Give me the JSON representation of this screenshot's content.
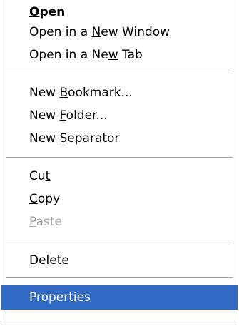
{
  "colors": {
    "highlight": "#316ac5",
    "highlight_text": "#ffffff",
    "disabled_text": "#a6a6a6",
    "separator": "#a0a0a0"
  },
  "menu": {
    "items": [
      {
        "before": "",
        "key": "O",
        "after": "pen",
        "state": "default-bold"
      },
      {
        "before": "Open in a ",
        "key": "N",
        "after": "ew Window",
        "state": "normal"
      },
      {
        "before": "Open in a Ne",
        "key": "w",
        "after": " Tab",
        "state": "normal"
      },
      {
        "before": "New ",
        "key": "B",
        "after": "ookmark...",
        "state": "normal"
      },
      {
        "before": "New ",
        "key": "F",
        "after": "older...",
        "state": "normal"
      },
      {
        "before": "New ",
        "key": "S",
        "after": "eparator",
        "state": "normal"
      },
      {
        "before": "Cu",
        "key": "t",
        "after": "",
        "state": "normal"
      },
      {
        "before": "",
        "key": "C",
        "after": "opy",
        "state": "normal"
      },
      {
        "before": "",
        "key": "P",
        "after": "aste",
        "state": "disabled"
      },
      {
        "before": "",
        "key": "D",
        "after": "elete",
        "state": "normal"
      },
      {
        "before": "Propert",
        "key": "i",
        "after": "es",
        "state": "selected"
      }
    ]
  }
}
